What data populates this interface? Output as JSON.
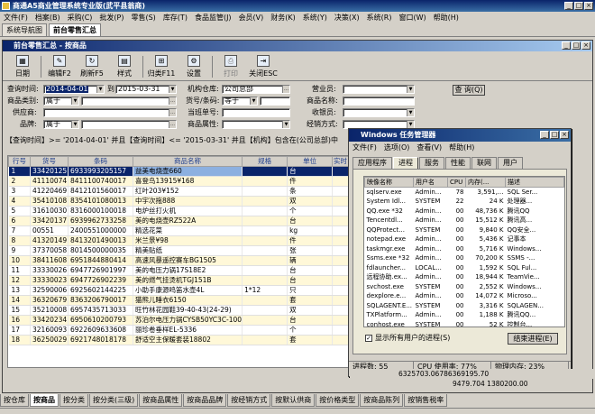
{
  "app": {
    "title": "商通A5商业管理系统专业版(武平县翁商)",
    "menu": [
      "文件(F)",
      "档案(B)",
      "采购(C)",
      "批发(P)",
      "零售(S)",
      "库存(T)",
      "食品监管(J)",
      "会员(V)",
      "财务(K)",
      "系统(Y)",
      "决策(X)",
      "系统(R)",
      "窗口(W)",
      "帮助(H)"
    ],
    "doc_tabs": [
      "系统导航图",
      "前台零售汇总"
    ]
  },
  "window": {
    "title": "前台零售汇总 - 按商品",
    "toolbar": [
      "日期",
      "编辑F2",
      "刷新F5",
      "样式",
      "归类F11",
      "设置",
      "打印",
      "关闭ESC"
    ]
  },
  "filters": {
    "query_time_label": "查询时间:",
    "date_from": "2014-04-01",
    "to_label": "到",
    "date_to": "2015-03-31",
    "warehouse_label": "机构仓库:",
    "warehouse_value": "公司总部",
    "clerk_label": "营业员:",
    "category_label": "商品类别:",
    "category_op": "属于",
    "code_label": "货号/条码:",
    "code_op": "等于",
    "name_label": "商品名称:",
    "supplier_label": "供应商:",
    "shift_label": "当班单号:",
    "cashier_label": "收银员:",
    "brand_label": "品牌:",
    "brand_op": "属于",
    "attr_label": "商品属性:",
    "method_label": "经销方式:",
    "query_button": "查 询(Q)"
  },
  "condition_text": "【查询时间】>= '2014-04-01' 并且【查询时间】<= '2015-03-31' 并且【机构】包含在(公司总部)中",
  "grid": {
    "columns": [
      "行号",
      "货号",
      "条码",
      "商品名称",
      "规格",
      "单位",
      "实时"
    ],
    "rows": [
      [
        "1",
        "33420125",
        "6933993205157",
        "益美电烧壶660",
        "",
        "台"
      ],
      [
        "2",
        "41110074",
        "8411100740017",
        "喜登鸟13915¥168",
        "",
        "件"
      ],
      [
        "3",
        "41220469",
        "8412101560017",
        "红叶203¥152",
        "",
        "条"
      ],
      [
        "4",
        "35410108",
        "8354101080013",
        "中宇次拖888",
        "",
        "双"
      ],
      [
        "5",
        "31610030",
        "8316000100018",
        "电炉丝打火机",
        "",
        "个"
      ],
      [
        "6",
        "33420137",
        "6939962733258",
        "美的电烧壶RZ522A",
        "",
        "台"
      ],
      [
        "7",
        "00551",
        "2400551000000",
        "精选花菜",
        "",
        "kg"
      ],
      [
        "8",
        "41320149",
        "8413201490013",
        "米兰景¥98",
        "",
        "件"
      ],
      [
        "9",
        "37370058",
        "8014500000035",
        "精美贴纸",
        "",
        "张"
      ],
      [
        "10",
        "38411608",
        "6951844880414",
        "高速风暴遥控赛车BG1505",
        "",
        "辆"
      ],
      [
        "11",
        "33330026",
        "6947726901997",
        "美的电压力锅17S18E2",
        "",
        "台"
      ],
      [
        "12",
        "33330023",
        "6947726902239",
        "美的燃气挂烫机TGJ151B",
        "",
        "台"
      ],
      [
        "13",
        "32590006",
        "6925602144225",
        "小助手康源鸣笛水壶4L",
        "1*12",
        "只"
      ],
      [
        "14",
        "36320679",
        "8363206790017",
        "猫熊儿睡衣6150",
        "",
        "套"
      ],
      [
        "15",
        "35210008",
        "6957435713033",
        "旺竹林花园鞋39-40-43(24-29)",
        "",
        "双"
      ],
      [
        "16",
        "33420234",
        "6950610200793",
        "苏泊尔电压力锅CYSB50YC3C-100",
        "",
        "台"
      ],
      [
        "17",
        "32160093",
        "6922609633608",
        "丽珍卷垂样EL-5336",
        "",
        "个"
      ],
      [
        "18",
        "36250029",
        "6921748018178",
        "舒适空主保暖套装18802",
        "",
        "套"
      ]
    ]
  },
  "totals_line1": "6325703.06786369195.70",
  "totals_line2": "9479.704   1380200.00",
  "bottom_tabs": [
    "按仓库",
    "按商品",
    "按分类",
    "按分类(三级)",
    "按商品属性",
    "按商品品牌",
    "按经销方式",
    "按默认供商",
    "按价格类型",
    "按商品陈列",
    "按销售税率"
  ],
  "task_manager": {
    "title": "Windows 任务管理器",
    "menu": [
      "文件(F)",
      "选项(O)",
      "查看(V)",
      "帮助(H)"
    ],
    "tabs": [
      "应用程序",
      "进程",
      "服务",
      "性能",
      "联网",
      "用户"
    ],
    "columns": [
      "映像名称",
      "用户名",
      "CPU",
      "内存(...",
      "描述"
    ],
    "rows": [
      [
        "sqlserv.exe",
        "Admin...",
        "78",
        "3,591,...",
        "SQL Ser..."
      ],
      [
        "System Idl...",
        "SYSTEM",
        "22",
        "24 K",
        "处理器..."
      ],
      [
        "QQ.exe *32",
        "Admin...",
        "00",
        "48,736 K",
        "腾讯QQ"
      ],
      [
        "Tencentdl...",
        "Admin...",
        "00",
        "15,512 K",
        "腾讯高..."
      ],
      [
        "QQProtect...",
        "SYSTEM",
        "00",
        "9,840 K",
        "QQ安全..."
      ],
      [
        "notepad.exe",
        "Admin...",
        "00",
        "5,436 K",
        "记事本"
      ],
      [
        "taskmgr.exe",
        "Admin...",
        "00",
        "5,716 K",
        "Windows..."
      ],
      [
        "Ssms.exe *32",
        "Admin...",
        "00",
        "70,200 K",
        "SSMS -..."
      ],
      [
        "fdlauncher...",
        "LOCAL...",
        "00",
        "1,592 K",
        "SQL Ful..."
      ],
      [
        "远程协助.ex...",
        "Admin...",
        "00",
        "18,944 K",
        "TeamVie..."
      ],
      [
        "svchost.exe",
        "SYSTEM",
        "00",
        "2,552 K",
        "Windows..."
      ],
      [
        "dexplore.e...",
        "Admin...",
        "00",
        "14,072 K",
        "Microso..."
      ],
      [
        "SQLAGENT.E...",
        "SYSTEM",
        "00",
        "3,316 K",
        "SQLAGEN..."
      ],
      [
        "TXPlatform...",
        "Admin...",
        "00",
        "1,188 K",
        "腾讯QQ..."
      ],
      [
        "conhost.exe",
        "SYSTEM",
        "00",
        "52 K",
        "控制台..."
      ]
    ],
    "show_all_label": "显示所有用户的进程(S)",
    "end_button": "结束进程(E)",
    "status": [
      "进程数: 55",
      "CPU 使用率: 77%",
      "物理内存: 23%"
    ]
  }
}
